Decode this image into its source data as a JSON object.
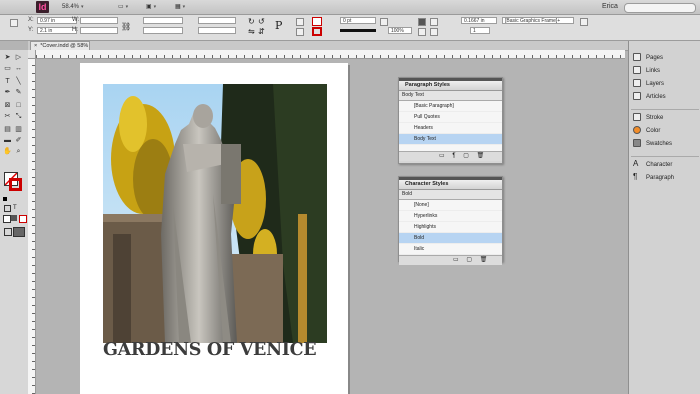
{
  "app": {
    "logo": "Id",
    "zoom": "58.4%",
    "user": "Erica"
  },
  "control": {
    "x": "0.97 in",
    "y": "2.1 in",
    "w_label": "W:",
    "h_label": "H:",
    "x_label": "X:",
    "y_label": "Y:",
    "stroke_weight": "0 pt",
    "opacity": "100%",
    "offset": "0.1667 in",
    "frame_style": "[Basic Graphics Frame]+",
    "columns": "1"
  },
  "document_tab": {
    "label": "*Cover.indd @ 58%"
  },
  "cover": {
    "title": "GARDENS OF VENICE"
  },
  "paragraph_styles": {
    "title": "Paragraph Styles",
    "current": "Body Text",
    "items": [
      "[Basic Paragraph]",
      "Pull Quotes",
      "Headers",
      "Body Text"
    ],
    "selected_index": 3
  },
  "character_styles": {
    "title": "Character Styles",
    "current": "Bold",
    "items": [
      "[None]",
      "Hyperlinks",
      "Highlights",
      "Bold",
      "Italic"
    ],
    "selected_index": 3
  },
  "dock": {
    "groups": [
      [
        "Pages",
        "Links",
        "Layers",
        "Articles"
      ],
      [
        "Stroke",
        "Color",
        "Swatches"
      ],
      [
        "Character",
        "Paragraph"
      ]
    ]
  },
  "tools": [
    "selection-icon",
    "direct-select-icon",
    "page-icon",
    "gap-icon",
    "type-icon",
    "line-icon",
    "pen-icon",
    "pencil-icon",
    "rect-frame-icon",
    "rect-icon",
    "scissors-icon",
    "transform-icon",
    "gradient-icon",
    "note-icon",
    "eyedropper-icon",
    "hand-icon",
    "zoom-icon"
  ]
}
